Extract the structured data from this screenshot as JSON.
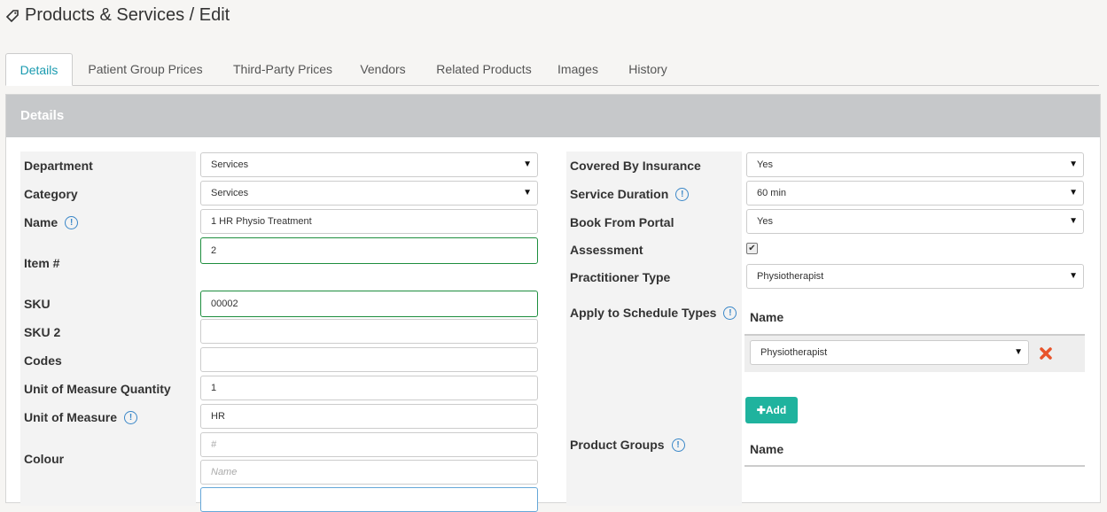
{
  "header": {
    "title": "Products & Services / Edit"
  },
  "tabs": [
    {
      "label": "Details",
      "active": true
    },
    {
      "label": "Patient Group Prices"
    },
    {
      "label": "Third-Party Prices"
    },
    {
      "label": "Vendors"
    },
    {
      "label": "Related Products"
    },
    {
      "label": "Images"
    },
    {
      "label": "History"
    }
  ],
  "panel": {
    "title": "Details"
  },
  "left": {
    "department": {
      "label": "Department",
      "value": "Services"
    },
    "category": {
      "label": "Category",
      "value": "Services"
    },
    "name": {
      "label": "Name",
      "value": "1 HR Physio Treatment"
    },
    "item": {
      "label": "Item #",
      "value": "2"
    },
    "sku": {
      "label": "SKU",
      "value": "00002"
    },
    "sku2": {
      "label": "SKU 2",
      "value": ""
    },
    "codes": {
      "label": "Codes",
      "value": ""
    },
    "uom_qty": {
      "label": "Unit of Measure Quantity",
      "value": "1"
    },
    "uom": {
      "label": "Unit of Measure",
      "value": "HR"
    },
    "colour": {
      "label": "Colour",
      "hash_placeholder": "#",
      "name_placeholder": "Name"
    }
  },
  "right": {
    "covered": {
      "label": "Covered By Insurance",
      "value": "Yes"
    },
    "duration": {
      "label": "Service Duration",
      "value": "60 min"
    },
    "portal": {
      "label": "Book From Portal",
      "value": "Yes"
    },
    "assessment": {
      "label": "Assessment",
      "checked": true
    },
    "practitioner": {
      "label": "Practitioner Type",
      "value": "Physiotherapist"
    },
    "schedule": {
      "label": "Apply to Schedule Types",
      "column": "Name",
      "row_value": "Physiotherapist",
      "add_label": "Add"
    },
    "groups": {
      "label": "Product Groups",
      "column": "Name"
    }
  },
  "icons": {
    "info": "info-circle-icon",
    "tag": "tag-icon",
    "delete": "delete-x-icon",
    "plus": "plus-icon"
  },
  "colors": {
    "accent": "#1a9bb0",
    "add_button": "#1fb39e",
    "valid_border": "#1e8e3e"
  }
}
